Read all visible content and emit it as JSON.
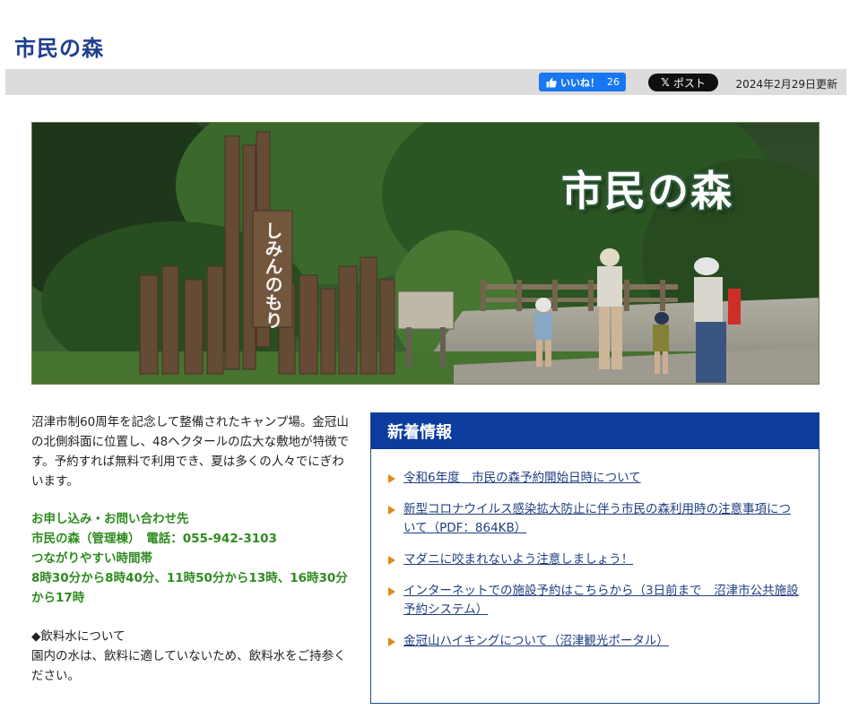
{
  "page": {
    "title": "市民の森"
  },
  "toolbar": {
    "like_label": "いいね！",
    "like_count": "26",
    "post_label": "ポスト",
    "updated": "2024年2月29日更新"
  },
  "hero": {
    "title": "市民の森",
    "sign_text": "しみんのもり",
    "icon": "photo-banner"
  },
  "intro": {
    "text": "沼津市制60周年を記念して整備されたキャンプ場。金冠山の北側斜面に位置し、48ヘクタールの広大な敷地が特徴です。予約すれば無料で利用でき、夏は多くの人々でにぎわいます。"
  },
  "contact": {
    "heading": "お申し込み・お問い合わせ先",
    "line": "市民の森（管理棟）　電話：055-942-3103",
    "hours_heading": "つながりやすい時間帯",
    "hours": "8時30分から8時40分、11時50分から13時、16時30分から17時"
  },
  "water": {
    "heading": "◆飲料水について",
    "text": "園内の水は、飲料に適していないため、飲料水をご持参ください。"
  },
  "news": {
    "title": "新着情報",
    "items": [
      {
        "label": "令和6年度　市民の森予約開始日時について"
      },
      {
        "label": "新型コロナウイルス感染拡大防止に伴う市民の森利用時の注意事項について（PDF：864KB）"
      },
      {
        "label": "マダニに咬まれないよう注意しましょう！"
      },
      {
        "label": "インターネットでの施設予約はこちらから（3日前まで　沼津市公共施設予約システム）"
      },
      {
        "label": "金冠山ハイキングについて（沼津観光ポータル）"
      }
    ]
  },
  "colors": {
    "title_blue": "#1e3f8f",
    "news_header": "#0b3c9e",
    "contact_green": "#2e8b1f",
    "arrow_orange": "#e08a1a",
    "like_blue": "#1877f2"
  }
}
